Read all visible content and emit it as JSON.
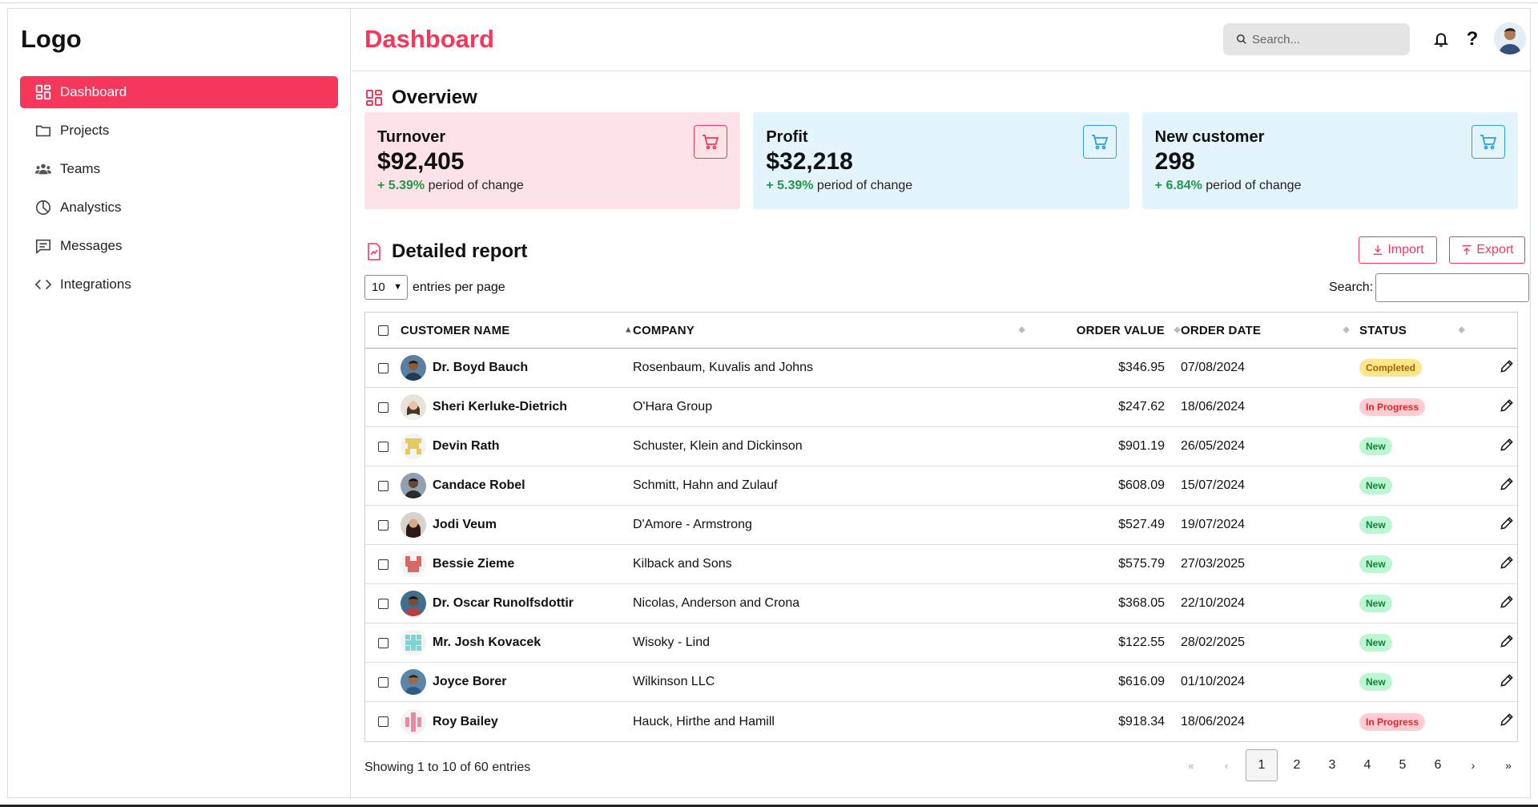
{
  "sidebar": {
    "logo": "Logo",
    "items": [
      {
        "label": "Dashboard",
        "icon": "grid-icon",
        "active": true
      },
      {
        "label": "Projects",
        "icon": "folder-icon"
      },
      {
        "label": "Teams",
        "icon": "users-icon"
      },
      {
        "label": "Analystics",
        "icon": "pie-chart-icon"
      },
      {
        "label": "Messages",
        "icon": "message-icon"
      },
      {
        "label": "Integrations",
        "icon": "code-icon"
      }
    ]
  },
  "header": {
    "title": "Dashboard",
    "search_placeholder": "Search..."
  },
  "overview": {
    "title": "Overview",
    "cards": [
      {
        "label": "Turnover",
        "value": "$92,405",
        "change": "+ 5.39%",
        "change_text": " period of change",
        "theme": "pink"
      },
      {
        "label": "Profit",
        "value": "$32,218",
        "change": "+ 5.39%",
        "change_text": " period of change",
        "theme": "blue"
      },
      {
        "label": "New customer",
        "value": "298",
        "change": "+ 6.84%",
        "change_text": " period of change",
        "theme": "blue"
      }
    ]
  },
  "report": {
    "title": "Detailed report",
    "import_label": "Import",
    "export_label": "Export",
    "entries_value": "10",
    "entries_label": "entries per page",
    "search_label": "Search:",
    "columns": [
      "CUSTOMER NAME",
      "COMPANY",
      "ORDER VALUE",
      "ORDER DATE",
      "STATUS"
    ],
    "rows": [
      {
        "name": "Dr. Boyd Bauch",
        "company": "Rosenbaum, Kuvalis and Johns",
        "value": "$346.95",
        "date": "07/08/2024",
        "status": "Completed",
        "kind": "completed",
        "avatar": "photo-1"
      },
      {
        "name": "Sheri Kerluke-Dietrich",
        "company": "O'Hara Group",
        "value": "$247.62",
        "date": "18/06/2024",
        "status": "In Progress",
        "kind": "progress",
        "avatar": "photo-2"
      },
      {
        "name": "Devin Rath",
        "company": "Schuster, Klein and Dickinson",
        "value": "$901.19",
        "date": "26/05/2024",
        "status": "New",
        "kind": "new",
        "avatar": "pixel-yellow"
      },
      {
        "name": "Candace Robel",
        "company": "Schmitt, Hahn and Zulauf",
        "value": "$608.09",
        "date": "15/07/2024",
        "status": "New",
        "kind": "new",
        "avatar": "photo-3"
      },
      {
        "name": "Jodi Veum",
        "company": "D'Amore - Armstrong",
        "value": "$527.49",
        "date": "19/07/2024",
        "status": "New",
        "kind": "new",
        "avatar": "photo-4"
      },
      {
        "name": "Bessie Zieme",
        "company": "Kilback and Sons",
        "value": "$575.79",
        "date": "27/03/2025",
        "status": "New",
        "kind": "new",
        "avatar": "pixel-red"
      },
      {
        "name": "Dr. Oscar Runolfsdottir",
        "company": "Nicolas, Anderson and Crona",
        "value": "$368.05",
        "date": "22/10/2024",
        "status": "New",
        "kind": "new",
        "avatar": "photo-5"
      },
      {
        "name": "Mr. Josh Kovacek",
        "company": "Wisoky - Lind",
        "value": "$122.55",
        "date": "28/02/2025",
        "status": "New",
        "kind": "new",
        "avatar": "pixel-teal"
      },
      {
        "name": "Joyce Borer",
        "company": "Wilkinson LLC",
        "value": "$616.09",
        "date": "01/10/2024",
        "status": "New",
        "kind": "new",
        "avatar": "photo-6"
      },
      {
        "name": "Roy Bailey",
        "company": "Hauck, Hirthe and Hamill",
        "value": "$918.34",
        "date": "18/06/2024",
        "status": "In Progress",
        "kind": "progress",
        "avatar": "pixel-pink"
      }
    ],
    "showing": "Showing 1 to 10 of 60 entries",
    "pages": [
      "1",
      "2",
      "3",
      "4",
      "5",
      "6"
    ],
    "current_page": "1"
  },
  "colors": {
    "accent": "#f4375b",
    "blue": "#2aa0e0",
    "green": "#1e9a48"
  }
}
